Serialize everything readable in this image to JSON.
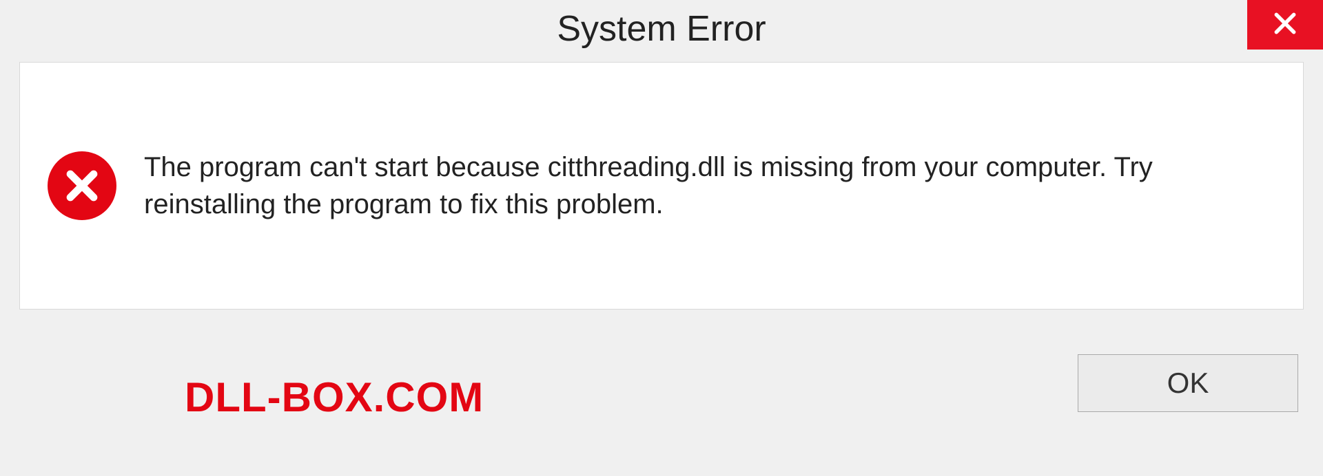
{
  "dialog": {
    "title": "System Error",
    "message": "The program can't start because citthreading.dll is missing from your computer. Try reinstalling the program to fix this problem.",
    "ok_label": "OK"
  },
  "watermark": "DLL-BOX.COM",
  "colors": {
    "close_bg": "#e81123",
    "error_icon_bg": "#e30613",
    "watermark_color": "#e30613"
  }
}
